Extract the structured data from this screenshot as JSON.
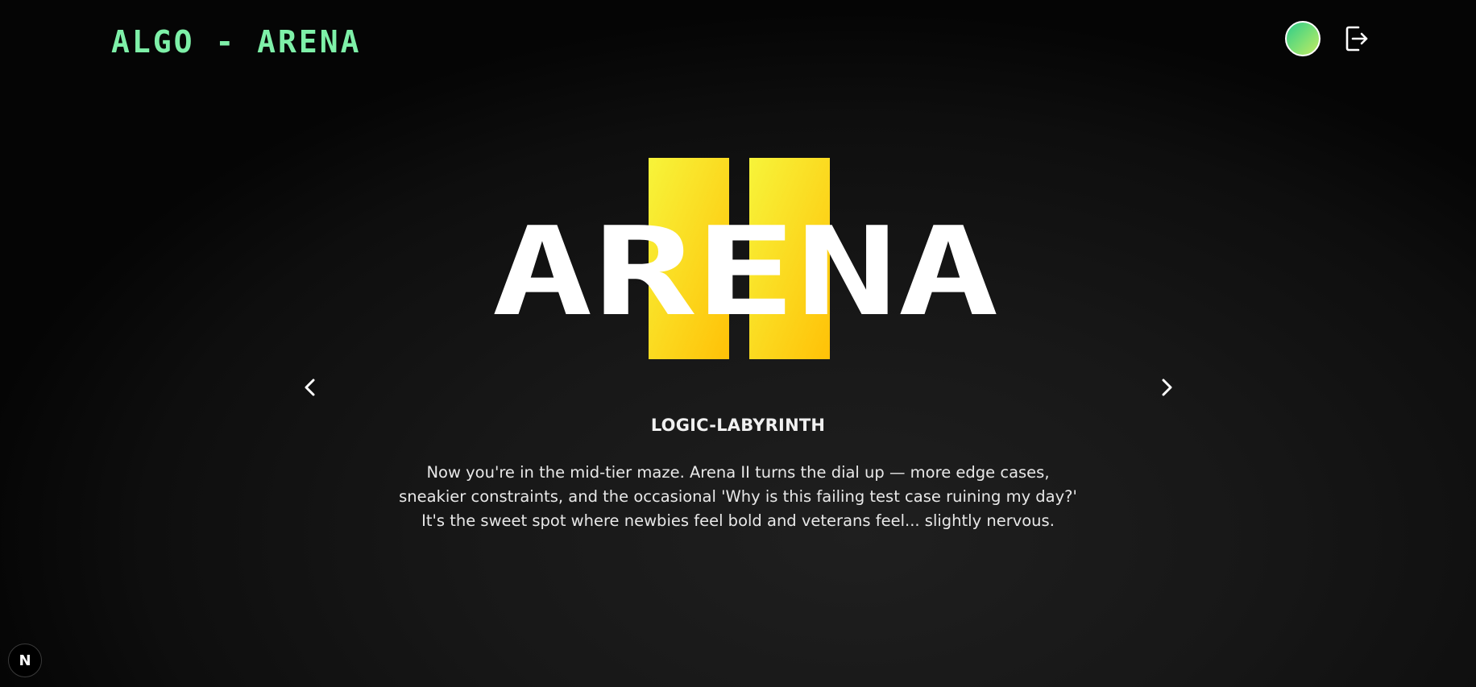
{
  "header": {
    "logo_text": "ALGO - ARENA",
    "logo_color": "#7ef0a8",
    "avatar_icon": "user-avatar",
    "logout_icon": "logout-icon"
  },
  "hero": {
    "title": "ARENA",
    "numeral": "II",
    "title_color": "#ffffff",
    "numeral_gradient": [
      "#f7f43a",
      "#ffc107"
    ]
  },
  "carousel": {
    "prev_icon": "chevron-left-icon",
    "next_icon": "chevron-right-icon"
  },
  "arena": {
    "name": "LOGIC-LABYRINTH",
    "description": "Now you're in the mid-tier maze. Arena II turns the dial up — more edge cases, sneakier constraints, and the occasional 'Why is this failing test case ruining my day?' It's the sweet spot where newbies feel bold and veterans feel... slightly nervous."
  },
  "dev_badge": {
    "label": "N"
  }
}
